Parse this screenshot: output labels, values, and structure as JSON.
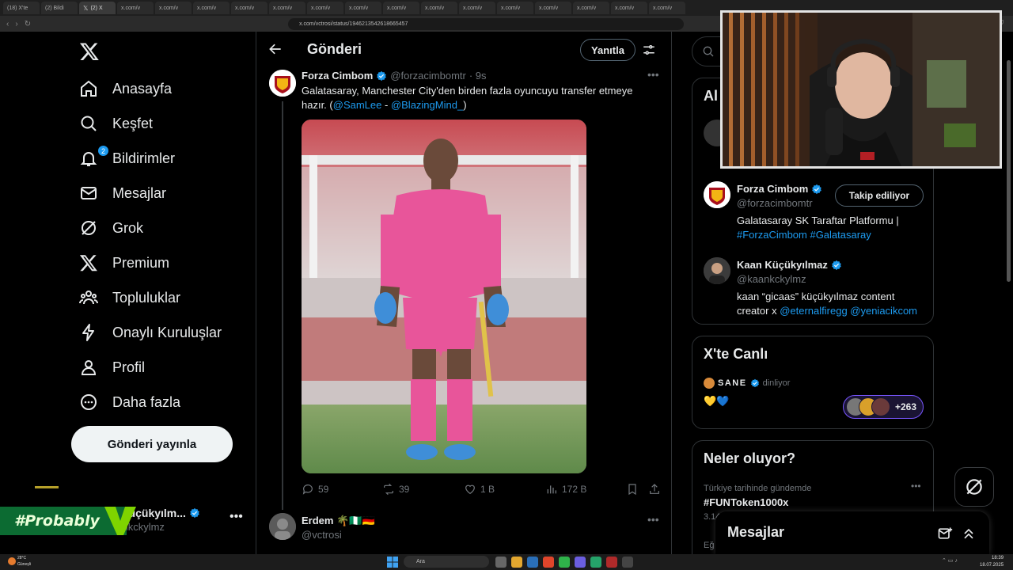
{
  "browser": {
    "tabs": [
      "(18) X'te",
      "(2) Bildi",
      "(2) X",
      "x.com/v",
      "x.com/v",
      "x.com/v",
      "x.com/v",
      "x.com/v",
      "x.com/v",
      "x.com/v",
      "x.com/v",
      "x.com/v",
      "x.com/v",
      "x.com/v",
      "x.com/v",
      "x.com/v",
      "x.com/v",
      "x.com/v",
      "x.com/v",
      "x.com/v"
    ],
    "url": "x.com/vctrosi/status/1946213542618665457"
  },
  "nav": {
    "items": [
      {
        "label": "Anasayfa",
        "icon": "home-icon"
      },
      {
        "label": "Keşfet",
        "icon": "search-icon"
      },
      {
        "label": "Bildirimler",
        "icon": "bell-icon",
        "badge": "2"
      },
      {
        "label": "Mesajlar",
        "icon": "mail-icon"
      },
      {
        "label": "Grok",
        "icon": "grok-icon"
      },
      {
        "label": "Premium",
        "icon": "x-icon"
      },
      {
        "label": "Topluluklar",
        "icon": "people-icon"
      },
      {
        "label": "Onaylı Kuruluşlar",
        "icon": "lightning-icon"
      },
      {
        "label": "Profil",
        "icon": "person-icon"
      },
      {
        "label": "Daha fazla",
        "icon": "more-circle-icon"
      }
    ],
    "post_button": "Gönderi yayınla"
  },
  "account": {
    "name": "n Küçükyılm...",
    "handle": "aankckylmz",
    "overlay_text": "#Probably"
  },
  "header": {
    "title": "Gönderi",
    "reply_button": "Yanıtla"
  },
  "tweet": {
    "name": "Forza Cimbom",
    "handle": "@forzacimbomtr",
    "time": "· 9s",
    "text_part1": "Galatasaray, Manchester City'den birden fazla oyuncuyu transfer etmeye hazır. (",
    "mention1": "@SamLee",
    "separator": " - ",
    "mention2": "@BlazingMind_",
    "text_end": ")",
    "replies": "59",
    "reposts": "39",
    "likes": "1 B",
    "views": "172 B"
  },
  "tweet2": {
    "name": "Erdem 🌴🇳🇬🇩🇪",
    "handle": "@vctrosi"
  },
  "right": {
    "search_placeholder": "A",
    "card1": {
      "title": "Al",
      "users": [
        {
          "name": "Forza Cimbom",
          "handle": "@forzacimbomtr",
          "button": "Takip ediliyor",
          "bio_text": "Galatasaray SK Taraftar Platformu |",
          "bio_tags": "#ForzaCimbom #Galatasaray"
        },
        {
          "name": "Kaan Küçükyılmaz",
          "handle": "@kaankckylmz",
          "bio_text": "kaan “gicaas” küçükyılmaz content creator x",
          "bio_tags": "@eternalfiregg @yeniacikcom"
        }
      ]
    },
    "live": {
      "title": "X'te Canlı",
      "host": "SANE",
      "status": "dinliyor",
      "emojis": "💛💙",
      "listener_count": "+263"
    },
    "trends": {
      "title": "Neler oluyor?",
      "meta": "Türkiye tarihinde gündemde",
      "tag": "#FUNToken1000x",
      "count": "3.14",
      "next_meta": "Eğ"
    }
  },
  "messages_drawer": {
    "title": "Mesajlar"
  },
  "taskbar": {
    "weather_temp": "28°C",
    "weather_desc": "Güneşli",
    "search_label": "Ara",
    "time": "18:39",
    "date": "18.07.2025"
  },
  "colors": {
    "accent": "#1d9bf0",
    "background": "#000000",
    "border": "#2f3336",
    "muted": "#71767b",
    "overlay_green": "#0c6b32"
  }
}
